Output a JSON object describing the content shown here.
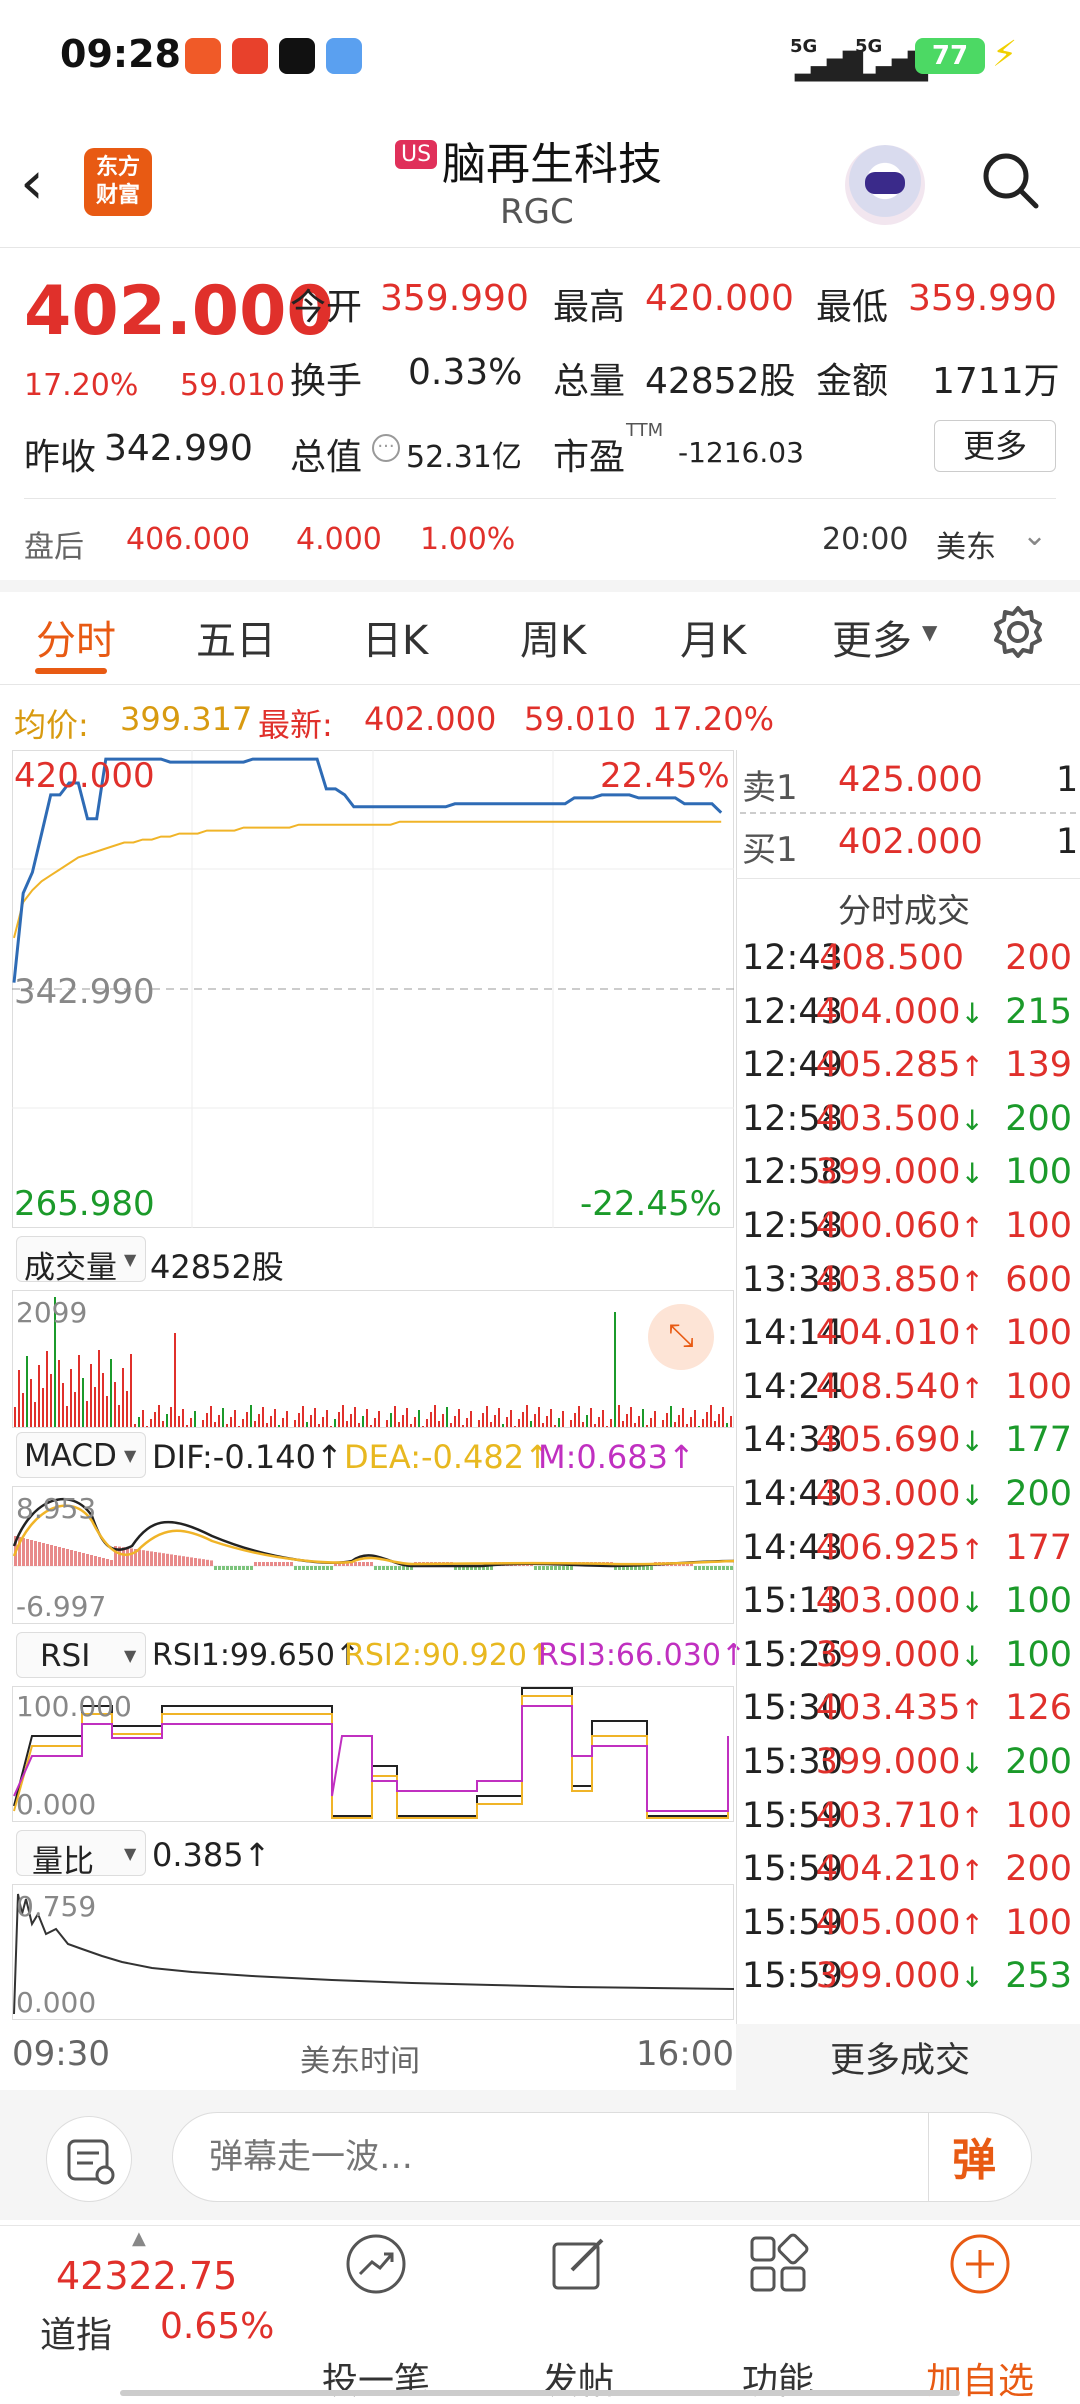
{
  "status_bar": {
    "time": "09:28",
    "battery": "77",
    "net1": "5G",
    "net2": "5G"
  },
  "header": {
    "badge": "US",
    "name": "脑再生科技",
    "code": "RGC",
    "logo_line1": "东方",
    "logo_line2": "财富"
  },
  "quote": {
    "price": "402.000",
    "change_pct": "17.20%",
    "change": "59.010",
    "open_label": "今开",
    "open": "359.990",
    "high_label": "最高",
    "high": "420.000",
    "low_label": "最低",
    "low": "359.990",
    "turnover_label": "换手",
    "turnover": "0.33%",
    "volume_label": "总量",
    "volume": "42852股",
    "amount_label": "金额",
    "amount": "1711万",
    "prev_label": "昨收",
    "prev_close": "342.990",
    "mktcap_label": "总值",
    "mktcap": "52.31亿",
    "pe_label": "市盈",
    "pe_sup": "TTM",
    "pe": "-1216.03",
    "more": "更多"
  },
  "after_hours": {
    "label": "盘后",
    "price": "406.000",
    "change": "4.000",
    "pct": "1.00%",
    "time": "20:00",
    "tz": "美东"
  },
  "tabs": [
    "分时",
    "五日",
    "日K",
    "周K",
    "月K",
    "更多"
  ],
  "chart_info": {
    "avg_label": "均价:",
    "avg": "399.317",
    "last_label": "最新:",
    "last": "402.000",
    "chg": "59.010",
    "pct": "17.20%"
  },
  "chart_data": {
    "type": "line",
    "y_top": "420.000",
    "y_top_pct": "22.45%",
    "y_mid": "342.990",
    "y_bottom": "265.980",
    "y_bottom_pct": "-22.45%",
    "x_start": "09:30",
    "x_mid": "美东时间",
    "x_end": "16:00",
    "ylim": [
      265.98,
      420.0
    ],
    "series": [
      {
        "name": "price",
        "color": "#2e6bb5",
        "values": [
          345,
          375,
          382,
          395,
          408,
          408,
          412,
          412,
          400,
          400,
          420,
          420,
          420,
          420,
          420,
          420,
          420,
          419,
          419,
          419,
          419,
          419,
          419,
          419,
          419,
          419,
          420,
          420,
          420,
          420,
          420,
          420,
          420,
          420,
          410,
          410,
          408,
          404,
          404,
          404,
          404,
          404,
          404,
          404,
          404,
          404,
          404,
          404,
          405,
          405,
          405,
          405,
          405,
          405,
          405,
          405,
          405,
          405,
          405,
          405,
          405,
          407,
          407,
          407,
          408,
          408,
          408,
          408,
          407,
          407,
          407,
          407,
          407,
          405,
          405,
          405,
          405,
          402
        ]
      },
      {
        "name": "avg",
        "color": "#f0b428",
        "values": [
          360,
          372,
          376,
          379,
          381,
          383,
          385,
          387,
          388,
          389,
          390,
          391,
          392,
          392,
          393,
          393,
          394,
          394,
          395,
          395,
          395,
          396,
          396,
          396,
          396,
          397,
          397,
          397,
          397,
          397,
          397,
          398,
          398,
          398,
          398,
          398,
          398,
          398,
          398,
          398,
          398,
          398,
          399,
          399,
          399,
          399,
          399,
          399,
          399,
          399,
          399,
          399,
          399,
          399,
          399,
          399,
          399,
          399,
          399,
          399,
          399,
          399,
          399,
          399,
          399,
          399,
          399,
          399,
          399,
          399,
          399,
          399,
          399,
          399,
          399,
          399,
          399,
          399
        ]
      }
    ]
  },
  "volume": {
    "label": "成交量",
    "value": "42852股",
    "max": "2099"
  },
  "macd": {
    "label": "MACD",
    "dif": "DIF:-0.140↑",
    "dea": "DEA:-0.482↑",
    "m": "M:0.683↑",
    "top": "8.953",
    "bottom": "-6.997"
  },
  "rsi": {
    "label": "RSI",
    "rsi1": "RSI1:99.650↑",
    "rsi2": "RSI2:90.920↑",
    "rsi3": "RSI3:66.030↑",
    "top": "100.000",
    "bottom": "0.000"
  },
  "ratio": {
    "label": "量比",
    "value": "0.385↑",
    "top": "0.759",
    "bottom": "0.000"
  },
  "orderbook": {
    "sell_label": "卖1",
    "sell_price": "425.000",
    "sell_qty": "1",
    "buy_label": "买1",
    "buy_price": "402.000",
    "buy_qty": "1",
    "title": "分时成交",
    "more": "更多成交"
  },
  "trades": [
    {
      "time": "12:43",
      "price": "408.500",
      "arrow": "",
      "qty": "200",
      "dir": "up"
    },
    {
      "time": "12:43",
      "price": "404.000",
      "arrow": "↓",
      "qty": "215",
      "dir": "down"
    },
    {
      "time": "12:49",
      "price": "405.285",
      "arrow": "↑",
      "qty": "139",
      "dir": "up"
    },
    {
      "time": "12:58",
      "price": "403.500",
      "arrow": "↓",
      "qty": "200",
      "dir": "down"
    },
    {
      "time": "12:58",
      "price": "399.000",
      "arrow": "↓",
      "qty": "100",
      "dir": "down"
    },
    {
      "time": "12:58",
      "price": "400.060",
      "arrow": "↑",
      "qty": "100",
      "dir": "up"
    },
    {
      "time": "13:38",
      "price": "403.850",
      "arrow": "↑",
      "qty": "600",
      "dir": "up"
    },
    {
      "time": "14:14",
      "price": "404.010",
      "arrow": "↑",
      "qty": "100",
      "dir": "up"
    },
    {
      "time": "14:24",
      "price": "408.540",
      "arrow": "↑",
      "qty": "100",
      "dir": "up"
    },
    {
      "time": "14:33",
      "price": "405.690",
      "arrow": "↓",
      "qty": "177",
      "dir": "down"
    },
    {
      "time": "14:43",
      "price": "403.000",
      "arrow": "↓",
      "qty": "200",
      "dir": "down"
    },
    {
      "time": "14:43",
      "price": "406.925",
      "arrow": "↑",
      "qty": "177",
      "dir": "up"
    },
    {
      "time": "15:13",
      "price": "403.000",
      "arrow": "↓",
      "qty": "100",
      "dir": "down"
    },
    {
      "time": "15:26",
      "price": "399.000",
      "arrow": "↓",
      "qty": "100",
      "dir": "down"
    },
    {
      "time": "15:30",
      "price": "403.435",
      "arrow": "↑",
      "qty": "126",
      "dir": "up"
    },
    {
      "time": "15:30",
      "price": "399.000",
      "arrow": "↓",
      "qty": "200",
      "dir": "down"
    },
    {
      "time": "15:59",
      "price": "403.710",
      "arrow": "↑",
      "qty": "100",
      "dir": "up"
    },
    {
      "time": "15:59",
      "price": "404.210",
      "arrow": "↑",
      "qty": "200",
      "dir": "up"
    },
    {
      "time": "15:59",
      "price": "405.000",
      "arrow": "↑",
      "qty": "100",
      "dir": "up"
    },
    {
      "time": "15:59",
      "price": "399.000",
      "arrow": "↓",
      "qty": "253",
      "dir": "down"
    }
  ],
  "chat": {
    "placeholder": "弹幕走一波…",
    "danmu": "弹"
  },
  "bottom_nav": {
    "index_value": "42322.75",
    "index_name": "道指",
    "index_pct": "0.65%",
    "items": [
      "投一笔",
      "发帖",
      "功能",
      "加自选"
    ]
  }
}
